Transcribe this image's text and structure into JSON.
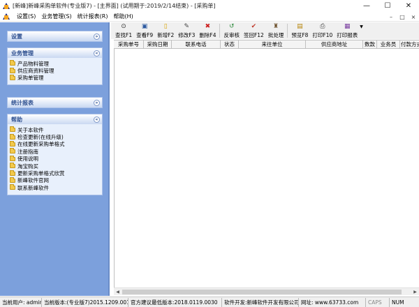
{
  "window": {
    "title": "[新峰]新峰采购单软件(专业版7) - [主界面] (试用期于:2019/2/14结束) - [采购单]",
    "minimize": "—",
    "maximize": "☐",
    "close": "✕"
  },
  "menubar": {
    "items": [
      "设置(S)",
      "业务管理(S)",
      "统计报表(R)",
      "帮助(H)"
    ],
    "right": [
      "–",
      "□",
      "×"
    ]
  },
  "sidebar": {
    "panels": [
      {
        "title": "设置",
        "chevron": "»",
        "items": []
      },
      {
        "title": "业务管理",
        "chevron": "«",
        "items": [
          "产品物料管理",
          "供应商资料管理",
          "采购单管理"
        ]
      },
      {
        "title": "统计报表",
        "chevron": "»",
        "items": []
      },
      {
        "title": "帮助",
        "chevron": "«",
        "items": [
          "关于本软件",
          "检查更新(在线升级)",
          "在线更新采购单格式",
          "注册指南",
          "使用说明",
          "淘宝购买",
          "更新采购单格式欣赏",
          "新峰软件官网",
          "联系新峰软件"
        ]
      }
    ]
  },
  "toolbar": {
    "buttons": [
      {
        "label": "查找F1",
        "icon": "binoculars-icon",
        "glyph": "⊙",
        "color": "#333333"
      },
      {
        "label": "查看F9",
        "icon": "view-icon",
        "glyph": "▣",
        "color": "#2d5aa0"
      },
      {
        "label": "新增F2",
        "icon": "new-document-icon",
        "glyph": "▯",
        "color": "#d9a400"
      },
      {
        "label": "修改F3",
        "icon": "edit-icon",
        "glyph": "✎",
        "color": "#444444"
      },
      {
        "label": "删除F4",
        "icon": "delete-icon",
        "glyph": "✖",
        "color": "#cc1f1f"
      },
      {
        "label": "反审核",
        "icon": "unapprove-icon",
        "glyph": "↺",
        "color": "#2e8b3d"
      },
      {
        "label": "签回F12",
        "icon": "checkmark-icon",
        "glyph": "✔",
        "color": "#c0392b"
      },
      {
        "label": "批处理",
        "icon": "batch-icon",
        "glyph": "♜",
        "color": "#6b4f2a"
      },
      {
        "label": "预览F8",
        "icon": "preview-icon",
        "glyph": "▤",
        "color": "#b8860b"
      },
      {
        "label": "打印F10",
        "icon": "printer-icon",
        "glyph": "⎙",
        "color": "#444444"
      },
      {
        "label": "打印报表",
        "icon": "report-icon",
        "glyph": "▦",
        "color": "#7a3ea0"
      }
    ],
    "dropdown_arrow": "▼"
  },
  "table": {
    "columns": [
      "采购单号",
      "采购日期",
      "联系电话",
      "状态",
      "来往单位",
      "供应商地址",
      "数款",
      "业务员",
      "付款方式",
      "录"
    ]
  },
  "scrollbar": {
    "left_arrow": "◀",
    "right_arrow": "▶"
  },
  "statusbar": {
    "user": "当前用户: admin",
    "version": "当前版本:(专业版7)2015.1209.0014",
    "min_version": "官方建议最低版本:2018.0119.0030",
    "developer": "软件开发:新峰软件开发有限公司",
    "website": "网址: www.63733.com",
    "caps": "CAPS",
    "num": "NUM"
  }
}
